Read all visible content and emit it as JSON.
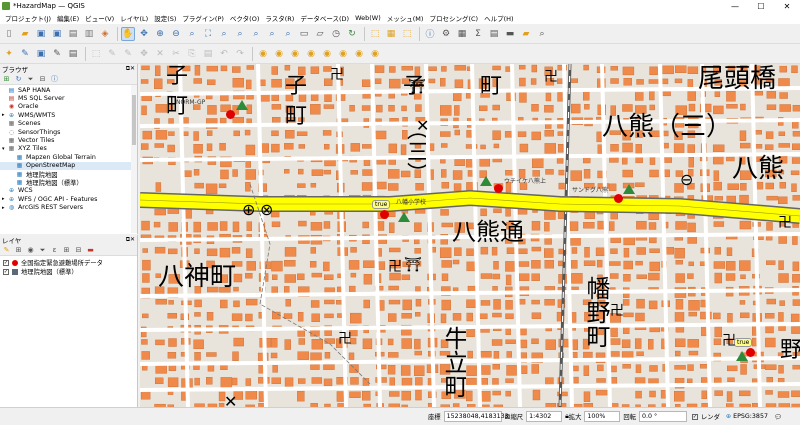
{
  "window": {
    "title": "*HazardMap — QGIS",
    "minimize": "—",
    "maximize": "☐",
    "close": "✕"
  },
  "menu": [
    "プロジェクト(J)",
    "編集(E)",
    "ビュー(V)",
    "レイヤ(L)",
    "設定(S)",
    "プラグイン(P)",
    "ベクタ(O)",
    "ラスタ(R)",
    "データベース(D)",
    "Web(W)",
    "メッシュ(M)",
    "プロセシング(C)",
    "ヘルプ(H)"
  ],
  "browser": {
    "title": "ブラウザ",
    "items": [
      {
        "label": "SAP HANA",
        "icon": "sap-hana-icon"
      },
      {
        "label": "MS SQL Server",
        "icon": "mssql-icon"
      },
      {
        "label": "Oracle",
        "icon": "oracle-icon"
      },
      {
        "label": "WMS/WMTS",
        "icon": "wms-icon"
      },
      {
        "label": "Scenes",
        "icon": "scenes-icon"
      },
      {
        "label": "SensorThings",
        "icon": "sensorthings-icon"
      },
      {
        "label": "Vector Tiles",
        "icon": "vector-tiles-icon"
      },
      {
        "label": "XYZ Tiles",
        "icon": "xyz-tiles-icon"
      },
      {
        "label": "Mapzen Global Terrain",
        "icon": "tile-icon"
      },
      {
        "label": "OpenStreetMap",
        "icon": "tile-icon"
      },
      {
        "label": "地理院地図",
        "icon": "tile-icon"
      },
      {
        "label": "地理院地図（標準）",
        "icon": "tile-icon"
      },
      {
        "label": "WCS",
        "icon": "wcs-icon"
      },
      {
        "label": "WFS / OGC API - Features",
        "icon": "wfs-icon"
      },
      {
        "label": "ArcGIS REST Servers",
        "icon": "arcgis-icon"
      }
    ]
  },
  "layers": {
    "title": "レイヤ",
    "items": [
      {
        "label": "全国指定緊急避難場所データ",
        "checked": "✓"
      },
      {
        "label": "地理院地図（標準）",
        "checked": "✓"
      }
    ]
  },
  "search": {
    "placeholder": "検索 (Ctrl+K)"
  },
  "status": {
    "coord_label": "座標",
    "coord_value": "15238048,4183133",
    "scale_label": "縮尺",
    "scale_value": "1:4302",
    "magnifier_label": "拡大",
    "magnifier_value": "100%",
    "rotation_label": "回転",
    "rotation_value": "0.0 °",
    "render_label": "レンダ",
    "crs_label": "EPSG:3857"
  },
  "map": {
    "labels": {
      "l1": "子",
      "l2": "町",
      "l3": "子",
      "l4": "町",
      "l5": "子",
      "l6": "町",
      "l7": "（三）",
      "l8": "尾頭橋",
      "l9": "八熊（三）",
      "l10": "八熊",
      "l11": "八熊通",
      "l12": "八神町",
      "l13": "幡野町",
      "l14": "牛立町",
      "l15": "野"
    },
    "points": [
      {
        "name": "NORM-GP",
        "flag": ""
      },
      {
        "name": "八幡小学校",
        "flag": "true"
      },
      {
        "name": "ウチイケ八熊上",
        "flag": ""
      },
      {
        "name": "サンドグ八熊",
        "flag": ""
      },
      {
        "name": "",
        "flag": "true"
      }
    ],
    "colors": {
      "building": "#f08a4b",
      "road": "#ffffff",
      "highway": "#ffff00",
      "ground": "#e8e4dc"
    }
  }
}
